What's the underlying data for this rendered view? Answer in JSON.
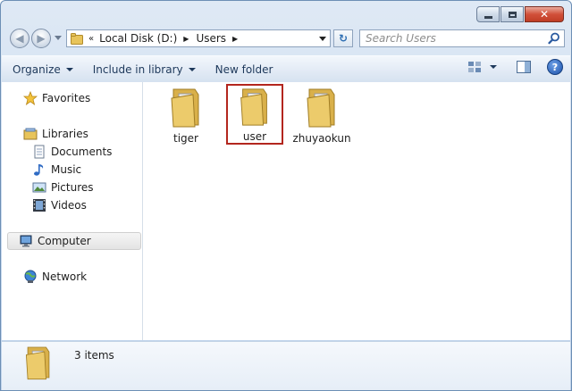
{
  "window": {
    "address": {
      "overflow_glyph": "«",
      "crumbs": [
        "Local Disk (D:)",
        "Users"
      ]
    },
    "search": {
      "placeholder": "Search Users"
    }
  },
  "toolbar": {
    "organize_label": "Organize",
    "include_label": "Include in library",
    "new_folder_label": "New folder"
  },
  "nav_pane": {
    "favorites": "Favorites",
    "libraries": "Libraries",
    "documents": "Documents",
    "music": "Music",
    "pictures": "Pictures",
    "videos": "Videos",
    "computer": "Computer",
    "network": "Network"
  },
  "content": {
    "items": [
      {
        "name": "tiger",
        "icon": "folder-icon"
      },
      {
        "name": "user",
        "icon": "folder-icon"
      },
      {
        "name": "zhuyaokun",
        "icon": "folder-icon"
      }
    ]
  },
  "details": {
    "count_text": "3 items"
  },
  "colors": {
    "accent": "#1e395b",
    "selection_outline": "#b3261e",
    "close_button": "#d1503a",
    "folder": "#e8c45a"
  }
}
